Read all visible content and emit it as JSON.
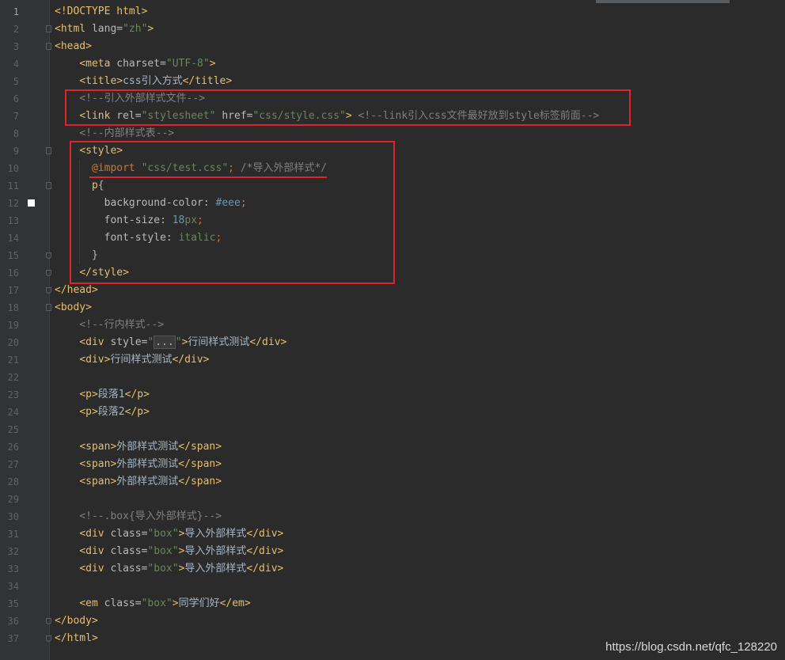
{
  "lines": [
    {
      "n": "1",
      "segs": [
        {
          "t": "<!DOCTYPE html>",
          "c": "tag"
        }
      ]
    },
    {
      "n": "2",
      "segs": [
        {
          "t": "<html ",
          "c": "tag"
        },
        {
          "t": "lang=",
          "c": "attr"
        },
        {
          "t": "\"zh\"",
          "c": "val"
        },
        {
          "t": ">",
          "c": "tag"
        }
      ]
    },
    {
      "n": "3",
      "segs": [
        {
          "t": "<head>",
          "c": "tag"
        }
      ]
    },
    {
      "n": "4",
      "segs": [
        {
          "t": "    "
        },
        {
          "t": "<meta ",
          "c": "tag"
        },
        {
          "t": "charset=",
          "c": "attr"
        },
        {
          "t": "\"UTF-8\"",
          "c": "val"
        },
        {
          "t": ">",
          "c": "tag"
        }
      ]
    },
    {
      "n": "5",
      "segs": [
        {
          "t": "    "
        },
        {
          "t": "<title>",
          "c": "tag"
        },
        {
          "t": "css引入方式",
          "c": "txt"
        },
        {
          "t": "</title>",
          "c": "tag"
        }
      ]
    },
    {
      "n": "6",
      "segs": [
        {
          "t": "    "
        },
        {
          "t": "<!--引入外部样式文件-->",
          "c": "cmt"
        }
      ]
    },
    {
      "n": "7",
      "segs": [
        {
          "t": "    "
        },
        {
          "t": "<link ",
          "c": "tag"
        },
        {
          "t": "rel=",
          "c": "attr"
        },
        {
          "t": "\"stylesheet\"",
          "c": "val"
        },
        {
          "t": " href=",
          "c": "attr"
        },
        {
          "t": "\"css/style.css\"",
          "c": "val"
        },
        {
          "t": ">",
          "c": "tag"
        },
        {
          "t": " "
        },
        {
          "t": "<!--link引入css文件最好放到style标签前面-->",
          "c": "cmt"
        }
      ]
    },
    {
      "n": "8",
      "segs": [
        {
          "t": "    "
        },
        {
          "t": "<!--内部样式表-->",
          "c": "cmt"
        }
      ]
    },
    {
      "n": "9",
      "segs": [
        {
          "t": "    "
        },
        {
          "t": "<style>",
          "c": "tag"
        }
      ]
    },
    {
      "n": "10",
      "segs": [
        {
          "t": "      "
        },
        {
          "t": "@import",
          "c": "at"
        },
        {
          "t": " "
        },
        {
          "t": "\"css/test.css\"",
          "c": "val"
        },
        {
          "t": ";",
          "c": "kw"
        },
        {
          "t": " "
        },
        {
          "t": "/*导入外部样式*/",
          "c": "cmt"
        }
      ]
    },
    {
      "n": "11",
      "segs": [
        {
          "t": "      "
        },
        {
          "t": "p",
          "c": "tag"
        },
        {
          "t": "{",
          "c": "txt"
        }
      ]
    },
    {
      "n": "12",
      "segs": [
        {
          "t": "        "
        },
        {
          "t": "background-color",
          "c": "attr"
        },
        {
          "t": ": ",
          "c": "txt"
        },
        {
          "t": "#eee",
          "c": "num"
        },
        {
          "t": ";",
          "c": "kw"
        }
      ]
    },
    {
      "n": "13",
      "segs": [
        {
          "t": "        "
        },
        {
          "t": "font-size",
          "c": "attr"
        },
        {
          "t": ": ",
          "c": "txt"
        },
        {
          "t": "18",
          "c": "num"
        },
        {
          "t": "px",
          "c": "val"
        },
        {
          "t": ";",
          "c": "kw"
        }
      ]
    },
    {
      "n": "14",
      "segs": [
        {
          "t": "        "
        },
        {
          "t": "font-style",
          "c": "attr"
        },
        {
          "t": ": ",
          "c": "txt"
        },
        {
          "t": "italic",
          "c": "val"
        },
        {
          "t": ";",
          "c": "kw"
        }
      ]
    },
    {
      "n": "15",
      "segs": [
        {
          "t": "      "
        },
        {
          "t": "}",
          "c": "txt"
        }
      ]
    },
    {
      "n": "16",
      "segs": [
        {
          "t": "    "
        },
        {
          "t": "</style>",
          "c": "tag"
        }
      ]
    },
    {
      "n": "17",
      "segs": [
        {
          "t": "</head>",
          "c": "tag"
        }
      ]
    },
    {
      "n": "18",
      "segs": [
        {
          "t": "<body>",
          "c": "tag"
        }
      ]
    },
    {
      "n": "19",
      "segs": [
        {
          "t": "    "
        },
        {
          "t": "<!--行内样式-->",
          "c": "cmt"
        }
      ]
    },
    {
      "n": "20",
      "segs": [
        {
          "t": "    "
        },
        {
          "t": "<div ",
          "c": "tag"
        },
        {
          "t": "style=",
          "c": "attr"
        },
        {
          "t": "\"",
          "c": "val"
        },
        {
          "t": "...",
          "c": "fold-text"
        },
        {
          "t": "\"",
          "c": "val"
        },
        {
          "t": ">",
          "c": "tag"
        },
        {
          "t": "行间样式测试",
          "c": "txt"
        },
        {
          "t": "</div>",
          "c": "tag"
        }
      ]
    },
    {
      "n": "21",
      "segs": [
        {
          "t": "    "
        },
        {
          "t": "<div>",
          "c": "tag"
        },
        {
          "t": "行间样式测试",
          "c": "txt"
        },
        {
          "t": "</div>",
          "c": "tag"
        }
      ]
    },
    {
      "n": "22",
      "segs": []
    },
    {
      "n": "23",
      "segs": [
        {
          "t": "    "
        },
        {
          "t": "<p>",
          "c": "tag"
        },
        {
          "t": "段落1",
          "c": "txt"
        },
        {
          "t": "</p>",
          "c": "tag"
        }
      ]
    },
    {
      "n": "24",
      "segs": [
        {
          "t": "    "
        },
        {
          "t": "<p>",
          "c": "tag"
        },
        {
          "t": "段落2",
          "c": "txt"
        },
        {
          "t": "</p>",
          "c": "tag"
        }
      ]
    },
    {
      "n": "25",
      "segs": []
    },
    {
      "n": "26",
      "segs": [
        {
          "t": "    "
        },
        {
          "t": "<span>",
          "c": "tag"
        },
        {
          "t": "外部样式测试",
          "c": "txt"
        },
        {
          "t": "</span>",
          "c": "tag"
        }
      ]
    },
    {
      "n": "27",
      "segs": [
        {
          "t": "    "
        },
        {
          "t": "<span>",
          "c": "tag"
        },
        {
          "t": "外部样式测试",
          "c": "txt"
        },
        {
          "t": "</span>",
          "c": "tag"
        }
      ]
    },
    {
      "n": "28",
      "segs": [
        {
          "t": "    "
        },
        {
          "t": "<span>",
          "c": "tag"
        },
        {
          "t": "外部样式测试",
          "c": "txt"
        },
        {
          "t": "</span>",
          "c": "tag"
        }
      ]
    },
    {
      "n": "29",
      "segs": []
    },
    {
      "n": "30",
      "segs": [
        {
          "t": "    "
        },
        {
          "t": "<!--.box{导入外部样式}-->",
          "c": "cmt"
        }
      ]
    },
    {
      "n": "31",
      "segs": [
        {
          "t": "    "
        },
        {
          "t": "<div ",
          "c": "tag"
        },
        {
          "t": "class=",
          "c": "attr"
        },
        {
          "t": "\"box\"",
          "c": "val"
        },
        {
          "t": ">",
          "c": "tag"
        },
        {
          "t": "导入外部样式",
          "c": "txt"
        },
        {
          "t": "</div>",
          "c": "tag"
        }
      ]
    },
    {
      "n": "32",
      "segs": [
        {
          "t": "    "
        },
        {
          "t": "<div ",
          "c": "tag"
        },
        {
          "t": "class=",
          "c": "attr"
        },
        {
          "t": "\"box\"",
          "c": "val"
        },
        {
          "t": ">",
          "c": "tag"
        },
        {
          "t": "导入外部样式",
          "c": "txt"
        },
        {
          "t": "</div>",
          "c": "tag"
        }
      ]
    },
    {
      "n": "33",
      "segs": [
        {
          "t": "    "
        },
        {
          "t": "<div ",
          "c": "tag"
        },
        {
          "t": "class=",
          "c": "attr"
        },
        {
          "t": "\"box\"",
          "c": "val"
        },
        {
          "t": ">",
          "c": "tag"
        },
        {
          "t": "导入外部样式",
          "c": "txt"
        },
        {
          "t": "</div>",
          "c": "tag"
        }
      ]
    },
    {
      "n": "34",
      "segs": []
    },
    {
      "n": "35",
      "segs": [
        {
          "t": "    "
        },
        {
          "t": "<em ",
          "c": "tag"
        },
        {
          "t": "class=",
          "c": "attr"
        },
        {
          "t": "\"box\"",
          "c": "val"
        },
        {
          "t": ">",
          "c": "tag"
        },
        {
          "t": "同学们好",
          "c": "txt"
        },
        {
          "t": "</em>",
          "c": "tag"
        }
      ]
    },
    {
      "n": "36",
      "segs": [
        {
          "t": "</body>",
          "c": "tag"
        }
      ]
    },
    {
      "n": "37",
      "segs": [
        {
          "t": "</html>",
          "c": "tag"
        }
      ]
    }
  ],
  "active_line": "1",
  "fold_open_lines": [
    "2",
    "3",
    "9",
    "11",
    "18"
  ],
  "fold_close_lines": [
    "15",
    "16",
    "17",
    "36",
    "37"
  ],
  "bookmark_line": "12",
  "watermark": "https://blog.csdn.net/qfc_128220",
  "colors": {
    "annotation": "#e0242b",
    "background": "#2b2b2b"
  }
}
